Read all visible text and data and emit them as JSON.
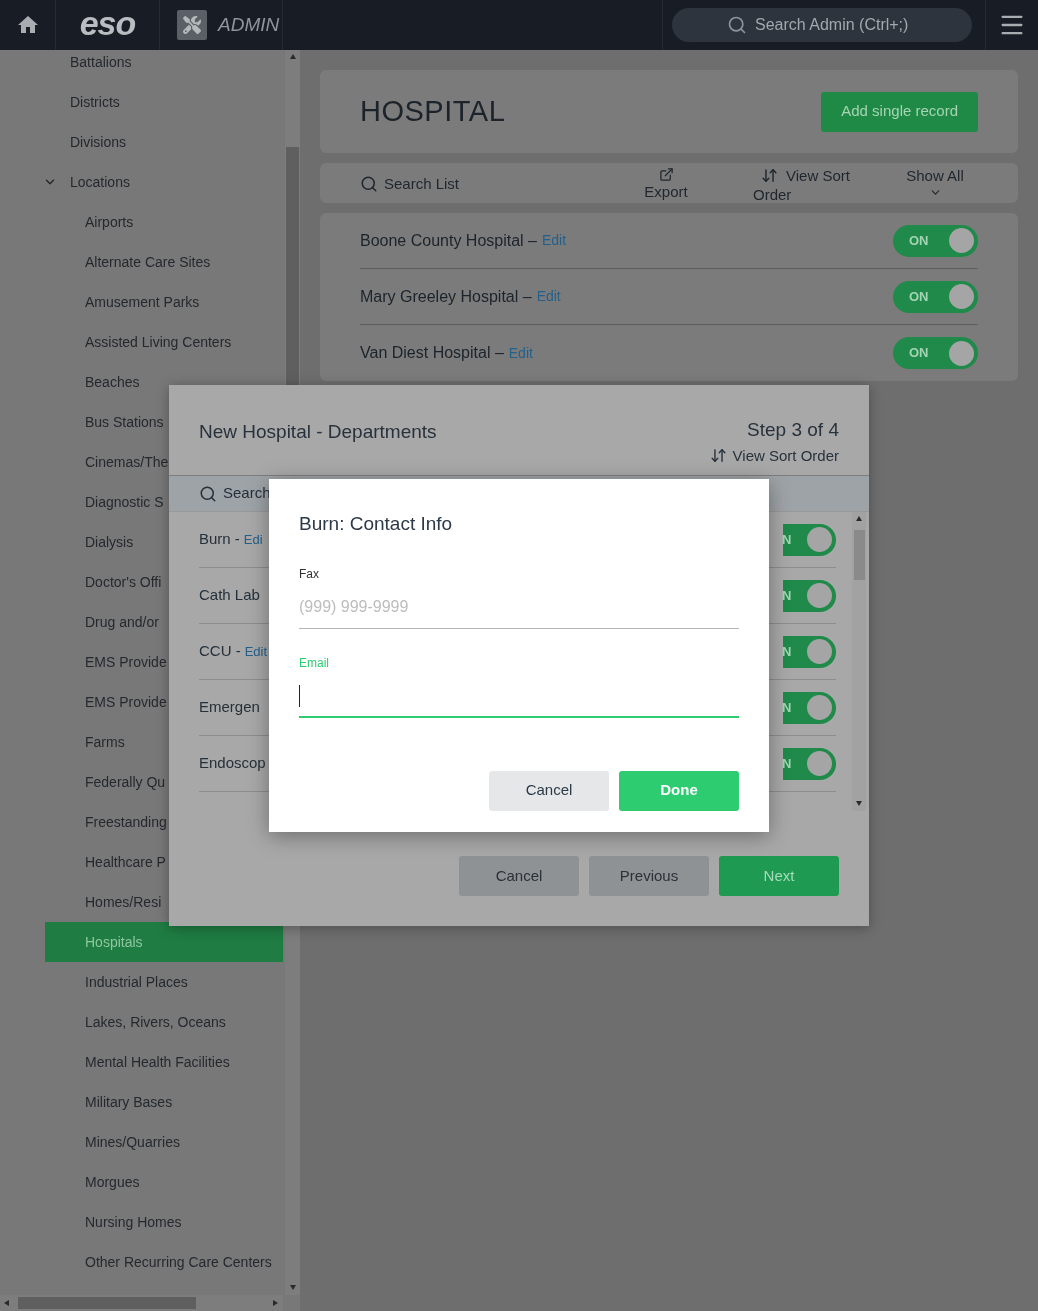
{
  "header": {
    "logo": "eso",
    "app_name": "ADMIN",
    "search": {
      "placeholder": "Search Admin (Ctrl+;)"
    }
  },
  "sidebar": {
    "items": [
      {
        "label": "Battalions",
        "selected": false
      },
      {
        "label": "Districts",
        "selected": false
      },
      {
        "label": "Divisions",
        "selected": false
      },
      {
        "label": "Locations",
        "selected": false,
        "expanded": true,
        "children": [
          {
            "label": "Airports",
            "selected": false
          },
          {
            "label": "Alternate Care Sites",
            "selected": false
          },
          {
            "label": "Amusement Parks",
            "selected": false
          },
          {
            "label": "Assisted Living Centers",
            "selected": false
          },
          {
            "label": "Beaches",
            "selected": false
          },
          {
            "label": "Bus Stations",
            "selected": false
          },
          {
            "label": "Cinemas/The",
            "selected": false
          },
          {
            "label": "Diagnostic S",
            "selected": false
          },
          {
            "label": "Dialysis",
            "selected": false
          },
          {
            "label": "Doctor's Offi",
            "selected": false
          },
          {
            "label": "Drug and/or",
            "selected": false
          },
          {
            "label": "EMS Provide",
            "selected": false
          },
          {
            "label": "EMS Provide",
            "selected": false
          },
          {
            "label": "Farms",
            "selected": false
          },
          {
            "label": "Federally Qu",
            "selected": false
          },
          {
            "label": "Freestanding",
            "selected": false
          },
          {
            "label": "Healthcare P",
            "selected": false
          },
          {
            "label": "Homes/Resi",
            "selected": false
          },
          {
            "label": "Hospitals",
            "selected": true
          },
          {
            "label": "Industrial Places",
            "selected": false
          },
          {
            "label": "Lakes, Rivers, Oceans",
            "selected": false
          },
          {
            "label": "Mental Health Facilities",
            "selected": false
          },
          {
            "label": "Military Bases",
            "selected": false
          },
          {
            "label": "Mines/Quarries",
            "selected": false
          },
          {
            "label": "Morgues",
            "selected": false
          },
          {
            "label": "Nursing Homes",
            "selected": false
          },
          {
            "label": "Other Recurring Care Centers",
            "selected": false
          }
        ]
      }
    ]
  },
  "page": {
    "title": "HOSPITAL",
    "add_button": "Add single record",
    "toolbar": {
      "search": "Search List",
      "export": "Export",
      "sort": "View Sort Order",
      "show_all": "Show All"
    },
    "records": [
      {
        "name": "Boone County Hospital –",
        "edit": "Edit",
        "toggle": "ON",
        "on": true
      },
      {
        "name": "Mary Greeley Hospital –",
        "edit": "Edit",
        "toggle": "ON",
        "on": true
      },
      {
        "name": "Van Diest Hospital –",
        "edit": "Edit",
        "toggle": "ON",
        "on": true
      }
    ]
  },
  "wizard": {
    "title": "New Hospital - Departments",
    "step": "Step 3 of 4",
    "sort": "View Sort Order",
    "search": "Search",
    "rows": [
      {
        "name": "Burn -",
        "edit": "Edi",
        "toggle": "N",
        "on": true
      },
      {
        "name": "Cath Lab",
        "toggle": "N",
        "on": true
      },
      {
        "name": "CCU -",
        "edit": "Edit",
        "toggle": "N",
        "on": true
      },
      {
        "name": "Emergen",
        "toggle": "N",
        "on": true
      },
      {
        "name": "Endoscop",
        "toggle": "N",
        "on": true
      }
    ],
    "buttons": [
      {
        "label": "Cancel",
        "kind": "secondary"
      },
      {
        "label": "Previous",
        "kind": "secondary"
      },
      {
        "label": "Next",
        "kind": "primary"
      }
    ]
  },
  "dialog": {
    "title": "Burn: Contact Info",
    "fields": [
      {
        "label": "Fax",
        "placeholder": "(999) 999-9999",
        "focused": false
      },
      {
        "label": "Email",
        "focused": true
      }
    ],
    "buttons": [
      {
        "label": "Cancel",
        "kind": "secondary"
      },
      {
        "label": "Done",
        "kind": "primary"
      }
    ]
  }
}
